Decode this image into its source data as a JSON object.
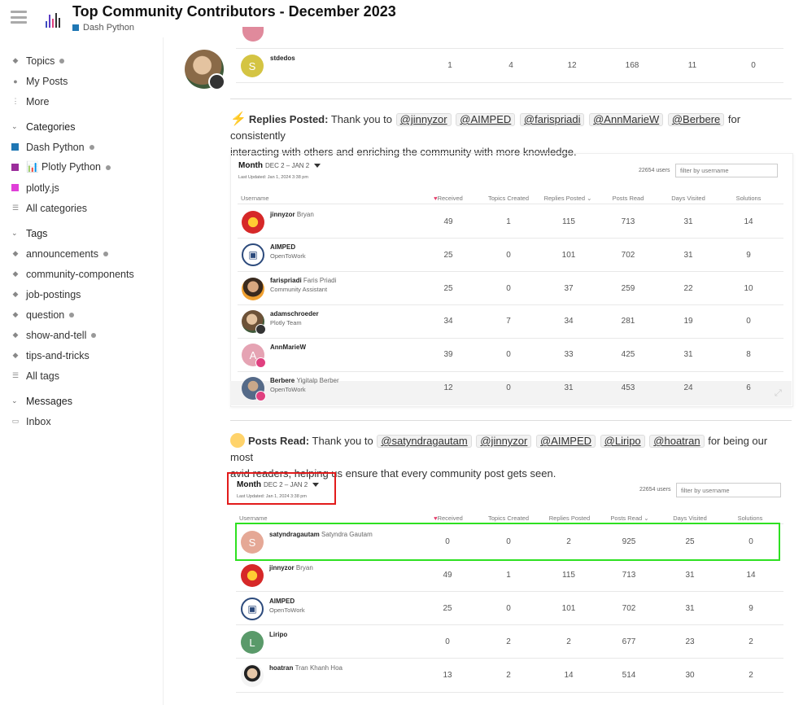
{
  "header": {
    "title": "Top Community Contributors - December 2023",
    "category": "Dash Python",
    "category_color": "#1f77b4"
  },
  "sidebar": {
    "top": [
      {
        "label": "Topics",
        "dot": true
      },
      {
        "label": "My Posts"
      },
      {
        "label": "More"
      }
    ],
    "categories_head": "Categories",
    "categories": [
      {
        "label": "Dash Python",
        "color": "#1f77b4",
        "dot": true
      },
      {
        "label": "📊 Plotly Python",
        "color": "#9b2d9b",
        "dot": true
      },
      {
        "label": "plotly.js",
        "color": "#e03fd8"
      },
      {
        "label": "All categories"
      }
    ],
    "tags_head": "Tags",
    "tags": [
      {
        "label": "announcements",
        "dot": true
      },
      {
        "label": "community-components"
      },
      {
        "label": "job-postings"
      },
      {
        "label": "question",
        "dot": true
      },
      {
        "label": "show-and-tell",
        "dot": true
      },
      {
        "label": "tips-and-tricks"
      },
      {
        "label": "All tags"
      }
    ],
    "messages_head": "Messages",
    "inbox": "Inbox"
  },
  "top_row": {
    "name": "stdedos",
    "initial": "S",
    "avatar_color": "#d4c443",
    "cells": [
      "1",
      "4",
      "12",
      "168",
      "11",
      "0"
    ]
  },
  "replies": {
    "heading": "Replies Posted:",
    "text_before": "Thank you to",
    "mentions": [
      "@jinnyzor",
      "@AIMPED",
      "@farispriadi",
      "@AnnMarieW",
      "@Berbere"
    ],
    "text_after_1": "for consistently",
    "text_line2": "interacting with others and enriching the community with more knowledge.",
    "month": "Month",
    "range": "DEC 2 – JAN 2",
    "updated": "Last Updated: Jan 1, 2024 3:38 pm",
    "users": "22654 users",
    "filter": "filter by username",
    "overlay_text": "",
    "columns": [
      "Username",
      "Received",
      "Topics Created",
      "Replies Posted",
      "Posts Read",
      "Days Visited",
      "Solutions"
    ],
    "rows": [
      {
        "name": "jinnyzor",
        "full": "Bryan",
        "sub": "",
        "cells": [
          "49",
          "1",
          "115",
          "713",
          "31",
          "14"
        ]
      },
      {
        "name": "AIMPED",
        "full": "",
        "sub": "OpenToWork",
        "cells": [
          "25",
          "0",
          "101",
          "702",
          "31",
          "9"
        ]
      },
      {
        "name": "farispriadi",
        "full": "Faris Priadi",
        "sub": "Community Assistant",
        "cells": [
          "25",
          "0",
          "37",
          "259",
          "22",
          "10"
        ]
      },
      {
        "name": "adamschroeder",
        "full": "",
        "sub": "Plotly Team",
        "cells": [
          "34",
          "7",
          "34",
          "281",
          "19",
          "0"
        ]
      },
      {
        "name": "AnnMarieW",
        "full": "",
        "sub": "",
        "cells": [
          "39",
          "0",
          "33",
          "425",
          "31",
          "8"
        ]
      },
      {
        "name": "Berbere",
        "full": "Yigitalp Berber",
        "sub": "OpenToWork",
        "cells": [
          "12",
          "0",
          "31",
          "453",
          "24",
          "6"
        ]
      }
    ]
  },
  "reads": {
    "heading": "Posts Read:",
    "text_before": "Thank you to",
    "mentions": [
      "@satyndragautam",
      "@jinnyzor",
      "@AIMPED",
      "@Liripo",
      "@hoatran"
    ],
    "text_after_1": "for being our most",
    "text_line2": "avid readers, helping us ensure that every community post gets seen.",
    "month": "Month",
    "range": "DEC 2 – JAN 2",
    "updated": "Last Updated: Jan 1, 2024 3:38 pm",
    "users": "22654 users",
    "filter": "filter by username",
    "columns": [
      "Username",
      "Received",
      "Topics Created",
      "Replies Posted",
      "Posts Read",
      "Days Visited",
      "Solutions"
    ],
    "rows": [
      {
        "name": "satyndragautam",
        "full": "Satyndra Gautam",
        "sub": "",
        "cells": [
          "0",
          "0",
          "2",
          "925",
          "25",
          "0"
        ]
      },
      {
        "name": "jinnyzor",
        "full": "Bryan",
        "sub": "",
        "cells": [
          "49",
          "1",
          "115",
          "713",
          "31",
          "14"
        ]
      },
      {
        "name": "AIMPED",
        "full": "",
        "sub": "OpenToWork",
        "cells": [
          "25",
          "0",
          "101",
          "702",
          "31",
          "9"
        ]
      },
      {
        "name": "Liripo",
        "full": "",
        "sub": "",
        "cells": [
          "0",
          "2",
          "2",
          "677",
          "23",
          "2"
        ]
      },
      {
        "name": "hoatran",
        "full": "Tran Khanh Hoa",
        "sub": "",
        "cells": [
          "13",
          "2",
          "14",
          "514",
          "30",
          "2"
        ]
      }
    ]
  }
}
